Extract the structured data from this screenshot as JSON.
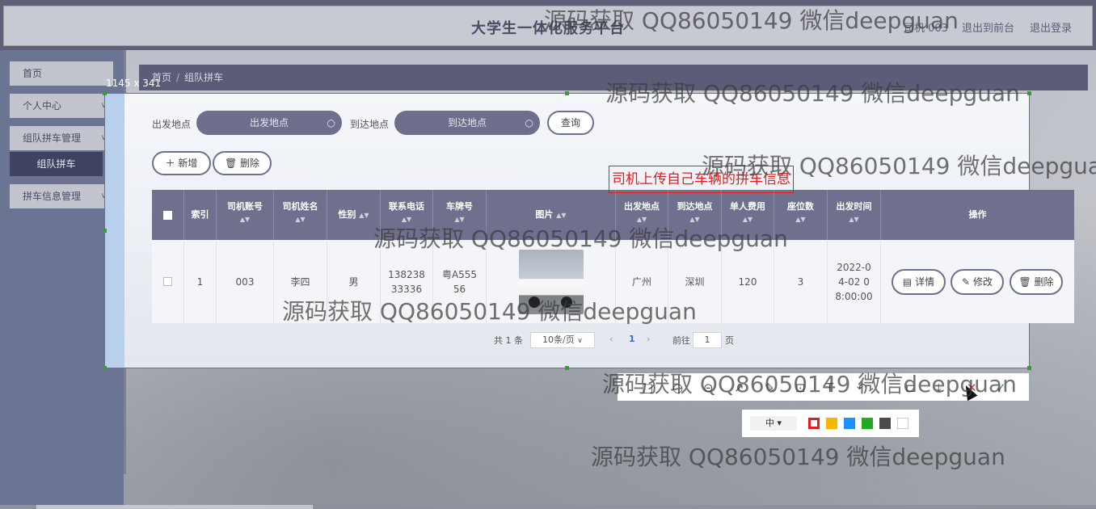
{
  "header": {
    "title": "大学生一体化服务平台",
    "links": [
      "司机 003",
      "退出到前台",
      "退出登录"
    ]
  },
  "sidebar": {
    "items": [
      {
        "label": "首页"
      },
      {
        "label": "个人中心"
      },
      {
        "label": "组队拼车管理"
      },
      {
        "label": "拼车信息管理"
      }
    ],
    "sub_item": "组队拼车"
  },
  "breadcrumb": {
    "home": "首页",
    "current": "组队拼车"
  },
  "capture": {
    "size_label": "1145 x 341"
  },
  "search": {
    "from_label": "出发地点",
    "from_placeholder": "出发地点",
    "to_label": "到达地点",
    "to_placeholder": "到达地点",
    "query_button": "查询"
  },
  "actions": {
    "add": "新增",
    "delete": "删除"
  },
  "annotation": "司机上传自己车辆的拼车信息",
  "table": {
    "headers": [
      "索引",
      "司机账号",
      "司机姓名",
      "性别",
      "联系电话",
      "车牌号",
      "图片",
      "出发地点",
      "到达地点",
      "单人费用",
      "座位数",
      "出发时间",
      "操作"
    ],
    "rows": [
      {
        "index": "1",
        "account": "003",
        "name": "李四",
        "gender": "男",
        "phone": "13823833336",
        "plate": "粤A55556",
        "from": "广州",
        "to": "深圳",
        "fee": "120",
        "seats": "3",
        "time": "2022-04-02 08:00:00"
      }
    ],
    "row_buttons": {
      "detail": "详情",
      "edit": "修改",
      "delete": "删除"
    }
  },
  "pagination": {
    "total": "共 1 条",
    "page_size": "10条/页",
    "current_page": "1",
    "goto_label": "前往",
    "goto_value": "1",
    "page_suffix": "页"
  },
  "toolbar": {
    "font_size": "中",
    "colors": [
      "#e02020",
      "#f5b800",
      "#1e90ff",
      "#22aa22",
      "#4a4a4a",
      "#ffffff"
    ]
  },
  "watermark": "源码获取 QQ86050149 微信deepguan"
}
